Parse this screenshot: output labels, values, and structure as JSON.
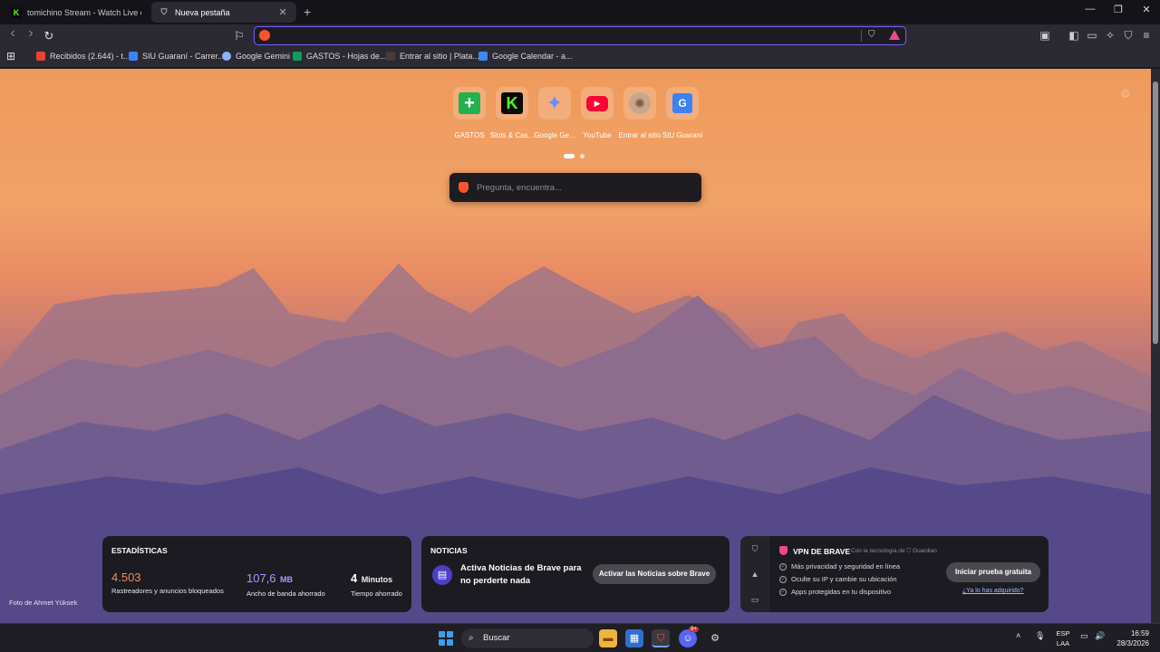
{
  "tabs": [
    {
      "title": "tomichino Stream - Watch Live on Ki",
      "favicon": "kick-icon"
    },
    {
      "title": "Nueva pestaña",
      "favicon": "brave-shield-icon",
      "active": true
    }
  ],
  "new_tab_label": "+",
  "window_controls": {
    "minimize": "—",
    "restore": "❐",
    "close": "✕"
  },
  "toolbar": {
    "back": "‹",
    "forward": "›",
    "reload": "↻",
    "bookmark": "⚐"
  },
  "address_bar": {
    "value": "",
    "placeholder": ""
  },
  "bookmarks": [
    {
      "label": "Recibidos (2.644) - t...",
      "color": "#ea4335"
    },
    {
      "label": "SIU Guaraní - Carrer...",
      "color": "#3b82f6"
    },
    {
      "label": "Google Gemini",
      "color": "#8ab4f8"
    },
    {
      "label": "GASTOS - Hojas de...",
      "color": "#0f9d58"
    },
    {
      "label": "Entrar al sitio | Plata...",
      "color": "#6b4b4b"
    },
    {
      "label": "Google Calendar - a...",
      "color": "#4285f4"
    }
  ],
  "top_sites": [
    {
      "label": "GASTOS",
      "color": "#22b14c",
      "glyph": "+"
    },
    {
      "label": "Slots & Cas...",
      "color": "#0b0b0b",
      "glyph": "K"
    },
    {
      "label": "Google Ge...",
      "color": "transparent",
      "glyph": "✦"
    },
    {
      "label": "YouTube",
      "color": "#ff0033",
      "glyph": "▶"
    },
    {
      "label": "Entrar al sitio",
      "color": "#c9a58b",
      "glyph": "✺"
    },
    {
      "label": "SIU Guaraní",
      "color": "#3b82f6",
      "glyph": "G"
    }
  ],
  "search": {
    "placeholder": "Pregunta, encuentra..."
  },
  "photo_credit": "Foto de Ahmet Yüksek",
  "stats": {
    "title": "ESTADÍSTICAS",
    "trackers_value": "4.503",
    "trackers_label": "Rastreadores y anuncios bloqueados",
    "bandwidth_value": "107,6",
    "bandwidth_unit": "MB",
    "bandwidth_label": "Ancho de banda ahorrado",
    "time_value": "4",
    "time_unit": "Minutos",
    "time_label": "Tiempo ahorrado",
    "trackers_color": "#f08a52",
    "bandwidth_color": "#a69cff"
  },
  "news": {
    "title": "NOTICIAS",
    "text": "Activa Noticias de Brave para no perderte nada",
    "button": "Activar las Noticias sobre Brave"
  },
  "vpn": {
    "title": "VPN DE BRAVE",
    "subtitle": "Con la tecnología de ⛉ Guardian",
    "features": [
      "Más privacidad y seguridad en línea",
      "Oculte su IP y cambie su ubicación",
      "Apps protegidas en tu dispositivo"
    ],
    "button": "Iniciar prueba gratuita",
    "link": "¿Ya lo has adquirido?"
  },
  "taskbar": {
    "search_label": "Buscar",
    "lang_line1": "ESP",
    "lang_line2": "LAA",
    "time": "16:59",
    "date": "28/3/2026",
    "discord_badge": "9+"
  }
}
